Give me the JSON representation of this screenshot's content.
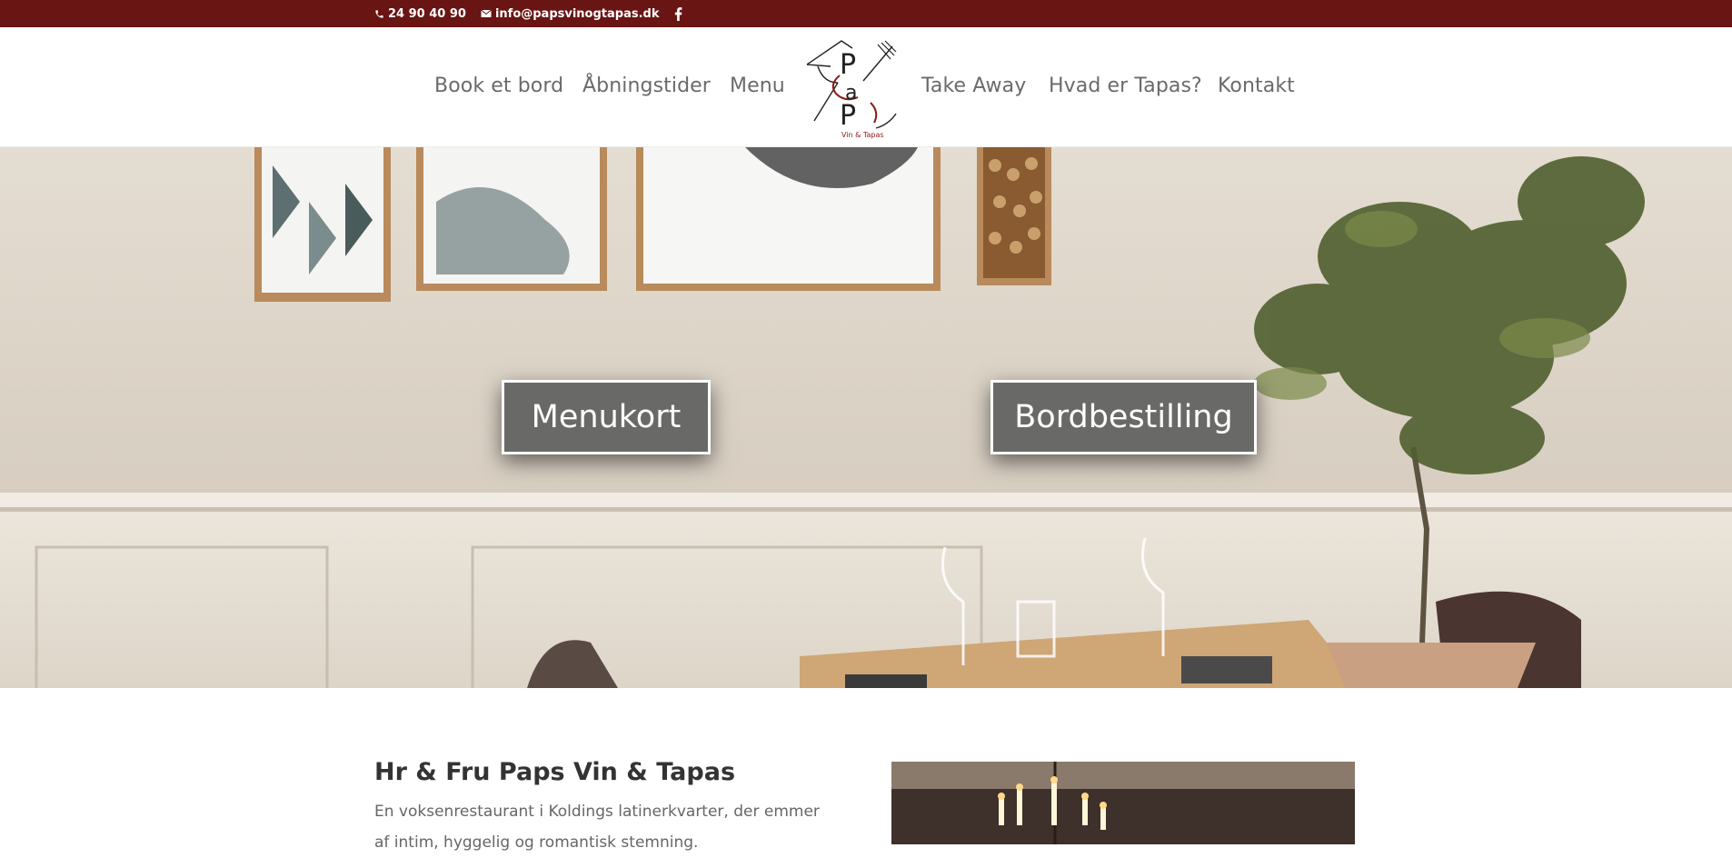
{
  "topbar": {
    "phone": "24 90 40 90",
    "email": "info@papsvinogtapas.dk",
    "phone_icon": "phone-icon",
    "email_icon": "envelope-icon",
    "social_icon": "facebook-icon"
  },
  "logo": {
    "letters": [
      "P",
      "a",
      "P"
    ],
    "tagline": "Vin & Tapas"
  },
  "nav": {
    "items": [
      {
        "label": "Book et bord"
      },
      {
        "label": "Åbningstider"
      },
      {
        "label": "Menu"
      },
      {
        "label": "Take Away"
      },
      {
        "label": "Hvad er Tapas?"
      },
      {
        "label": "Kontakt"
      }
    ]
  },
  "hero": {
    "buttons": [
      {
        "label": "Menukort"
      },
      {
        "label": "Bordbestilling"
      }
    ]
  },
  "intro": {
    "title": "Hr & Fru Paps Vin & Tapas",
    "text": "En voksenrestaurant i Koldings latinerkvarter, der emmer af intim, hyggelig og romantisk stemning."
  },
  "colors": {
    "topbar": "#681513",
    "nav_text": "#6a6a6a",
    "button_bg": "#606060",
    "logo_accent": "#8b1a17"
  }
}
